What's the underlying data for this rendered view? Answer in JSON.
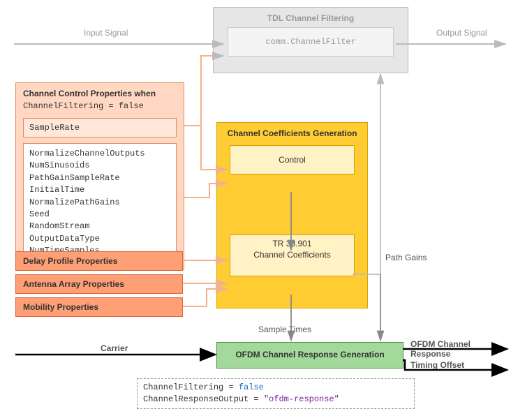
{
  "io": {
    "input": "Input Signal",
    "output": "Output Signal",
    "carrier": "Carrier",
    "pathGains": "Path Gains",
    "sampleTimes": "Sample Times",
    "ofdmResp": "OFDM Channel Response",
    "timingOffset": "Timing Offset"
  },
  "tdl": {
    "title": "TDL Channel Filtering",
    "inner": "comm.ChannelFilter"
  },
  "cc": {
    "title": "Channel Control Properties when",
    "subtitle": "ChannelFiltering = false",
    "sampleRate": "SampleRate",
    "props": [
      "NormalizeChannelOutputs",
      "NumSinusoids",
      "PathGainSampleRate",
      "InitialTime",
      "NormalizePathGains",
      "Seed",
      "RandomStream",
      "OutputDataType",
      "NumTimeSamples"
    ]
  },
  "orangeButtons": {
    "delay": "Delay Profile Properties",
    "antenna": "Antenna Array Properties",
    "mobility": "Mobility Properties"
  },
  "gold": {
    "title": "Channel Coefficients Generation",
    "control": "Control",
    "coeffLine1": "TR 38.901",
    "coeffLine2": "Channel Coefficients"
  },
  "ofdm": {
    "label": "OFDM Channel Response Generation"
  },
  "code": {
    "line1Key": "ChannelFiltering",
    "eq": " = ",
    "line1Val": "false",
    "line2Key": "ChannelResponseOutput",
    "line2Val": "\"ofdm-response\""
  },
  "chart_data": {
    "type": "flow-diagram",
    "nodes": [
      {
        "id": "input",
        "label": "Input Signal",
        "kind": "io"
      },
      {
        "id": "tdl",
        "label": "TDL Channel Filtering",
        "inner": "comm.ChannelFilter",
        "kind": "module"
      },
      {
        "id": "output",
        "label": "Output Signal",
        "kind": "io"
      },
      {
        "id": "ccProps",
        "label": "Channel Control Properties when ChannelFiltering = false",
        "items": [
          "SampleRate",
          "NormalizeChannelOutputs",
          "NumSinusoids",
          "PathGainSampleRate",
          "InitialTime",
          "NormalizePathGains",
          "Seed",
          "RandomStream",
          "OutputDataType",
          "NumTimeSamples"
        ],
        "kind": "props"
      },
      {
        "id": "delay",
        "label": "Delay Profile Properties",
        "kind": "props"
      },
      {
        "id": "antenna",
        "label": "Antenna Array Properties",
        "kind": "props"
      },
      {
        "id": "mobility",
        "label": "Mobility Properties",
        "kind": "props"
      },
      {
        "id": "gen",
        "label": "Channel Coefficients Generation",
        "kind": "module"
      },
      {
        "id": "control",
        "label": "Control",
        "parent": "gen",
        "kind": "sub"
      },
      {
        "id": "coeff",
        "label": "TR 38.901 Channel Coefficients",
        "parent": "gen",
        "kind": "sub"
      },
      {
        "id": "ofdm",
        "label": "OFDM Channel Response Generation",
        "kind": "module"
      },
      {
        "id": "carrier",
        "label": "Carrier",
        "kind": "io"
      },
      {
        "id": "ofdmResp",
        "label": "OFDM Channel Response",
        "kind": "io"
      },
      {
        "id": "timingOffset",
        "label": "Timing Offset",
        "kind": "io"
      }
    ],
    "settings": {
      "ChannelFiltering": false,
      "ChannelResponseOutput": "ofdm-response"
    },
    "edges": [
      {
        "from": "input",
        "to": "tdl",
        "style": "greyed"
      },
      {
        "from": "tdl",
        "to": "output",
        "style": "greyed"
      },
      {
        "from": "ccProps.SampleRate",
        "to": "tdl",
        "style": "greyed"
      },
      {
        "from": "ccProps.SampleRate",
        "to": "control"
      },
      {
        "from": "ccProps",
        "to": "control"
      },
      {
        "from": "delay",
        "to": "coeff"
      },
      {
        "from": "antenna",
        "to": "coeff"
      },
      {
        "from": "mobility",
        "to": "coeff"
      },
      {
        "from": "control",
        "to": "coeff"
      },
      {
        "from": "coeff",
        "to": "tdl",
        "label": "Path Gains",
        "style": "greyed"
      },
      {
        "from": "coeff",
        "to": "ofdm",
        "label": "Path Gains"
      },
      {
        "from": "coeff",
        "to": "ofdm",
        "label": "Sample Times"
      },
      {
        "from": "carrier",
        "to": "ofdm"
      },
      {
        "from": "ofdm",
        "to": "ofdmResp"
      },
      {
        "from": "ofdm",
        "to": "timingOffset"
      }
    ]
  }
}
